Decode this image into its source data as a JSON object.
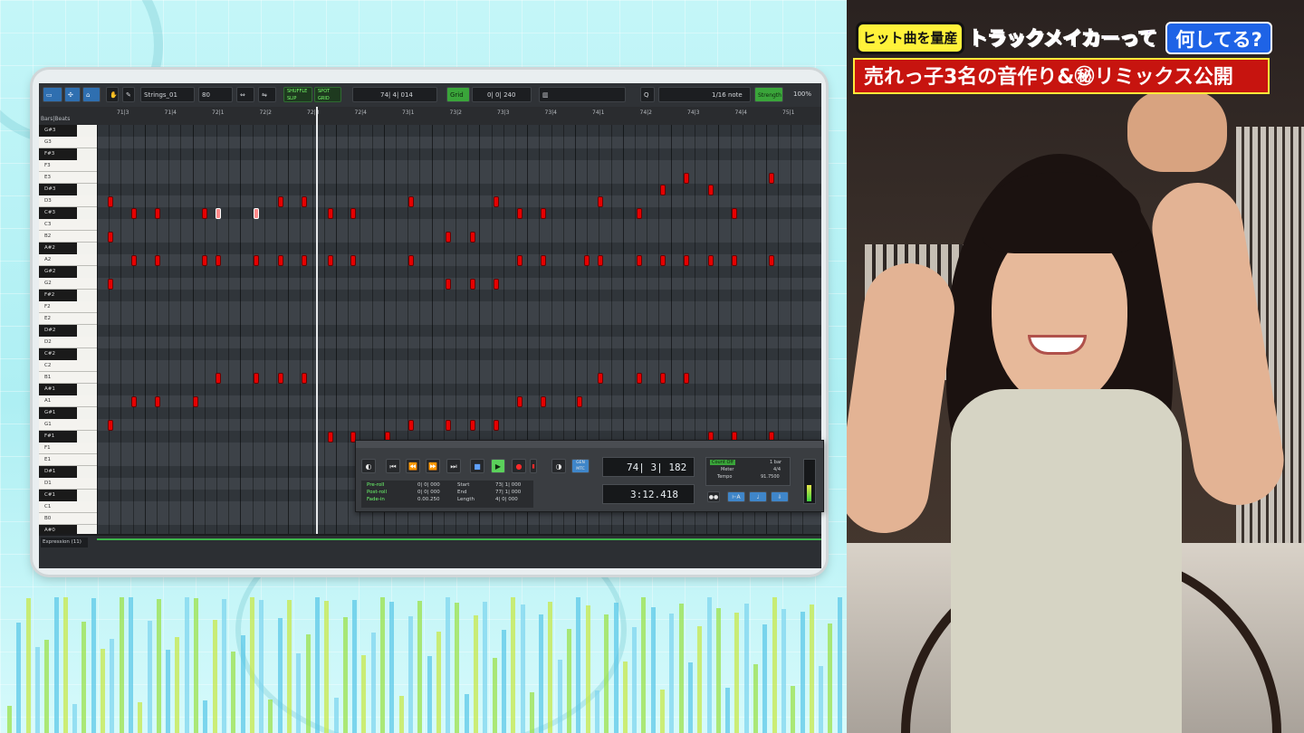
{
  "captions": {
    "badge": "ヒット曲を量産",
    "headline_purple": "トラックメイカーって",
    "headline_blue": "何してる?",
    "subline": "売れっ子3名の音作り&㊙リミックス公開"
  },
  "daw": {
    "toolbar": {
      "track_name": "Strings_01",
      "value_80": "80",
      "shuffle_label": "SHUFFLE",
      "spot_label": "SPOT",
      "slip_label": "SLIP",
      "grid_label": "GRID",
      "main_counter": "74| 4| 014",
      "counter_b": "80",
      "grid_button": "Grid",
      "grid_value": "0| 0| 240",
      "note_value": "1/16 note",
      "strength_button": "Strength",
      "strength_value": "100%"
    },
    "ruler_label": "Bars|Beats",
    "ruler_ticks": [
      "71|3",
      "71|4",
      "72|1",
      "72|2",
      "72|3",
      "72|4",
      "73|1",
      "73|2",
      "73|3",
      "73|4",
      "74|1",
      "74|2",
      "74|3",
      "74|4",
      "75|1"
    ],
    "keys": [
      "G#3",
      "G3",
      "F#3",
      "F3",
      "E3",
      "D#3",
      "D3",
      "C#3",
      "C3",
      "B2",
      "A#2",
      "A2",
      "G#2",
      "G2",
      "F#2",
      "F2",
      "E2",
      "D#2",
      "D2",
      "C#2",
      "C2",
      "B1",
      "A#1",
      "A1",
      "G#1",
      "G1",
      "F#1",
      "F1",
      "E1",
      "D#1",
      "D1",
      "C#1",
      "C1",
      "B0",
      "A#0"
    ],
    "expression_lane": "Expression (11)",
    "transport": {
      "preroll_label": "Pre-roll",
      "postroll_label": "Post-roll",
      "fadein_label": "Fade-in",
      "preroll_value": "0| 0| 000",
      "postroll_value": "0| 0| 000",
      "fadein_value": "0.00.250",
      "start_label": "Start",
      "end_label": "End",
      "length_label": "Length",
      "start_value": "73| 1| 000",
      "end_value": "77| 1| 000",
      "length_value": "4| 0| 000",
      "main_counter": "74| 3| 182",
      "sub_counter": "3:12.418",
      "gen_mtc": "GEN MTC",
      "countoff": "Count Off",
      "meter_label": "Meter",
      "meter_value": "4/4",
      "tempo_label": "Tempo",
      "tempo_value": "91.7500",
      "bars_value": "1 bar"
    }
  },
  "colors": {
    "note_red": "#e60000",
    "accent_green": "#3aa53a",
    "caption_yellow": "#fff23a",
    "caption_red": "#c7140f",
    "caption_blue": "#1e63e6",
    "caption_purple": "#7b2fe0"
  }
}
